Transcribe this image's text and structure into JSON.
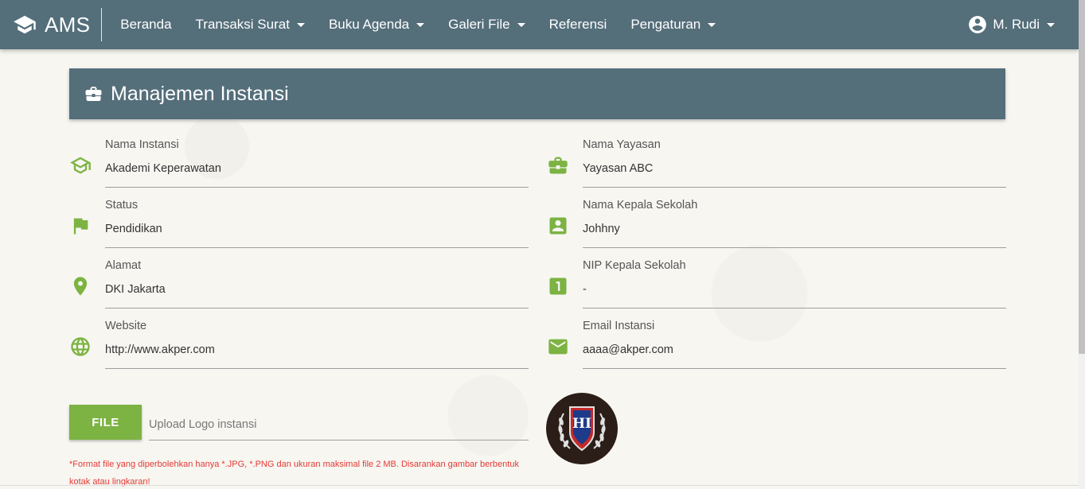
{
  "brand": {
    "name": "AMS",
    "icon": "graduation-cap-icon"
  },
  "nav": {
    "items": [
      {
        "label": "Beranda",
        "dropdown": false
      },
      {
        "label": "Transaksi Surat",
        "dropdown": true
      },
      {
        "label": "Buku Agenda",
        "dropdown": true
      },
      {
        "label": "Galeri File",
        "dropdown": true
      },
      {
        "label": "Referensi",
        "dropdown": false
      },
      {
        "label": "Pengaturan",
        "dropdown": true
      }
    ],
    "user": {
      "name": "M. Rudi",
      "icon": "account-circle-icon"
    }
  },
  "card": {
    "title": "Manajemen Instansi",
    "icon": "briefcase-icon"
  },
  "fields": {
    "nama_instansi": {
      "label": "Nama Instansi",
      "value": "Akademi Keperawatan",
      "icon": "school-icon"
    },
    "status": {
      "label": "Status",
      "value": "Pendidikan",
      "icon": "flag-icon"
    },
    "alamat": {
      "label": "Alamat",
      "value": "DKI Jakarta",
      "icon": "location-pin-icon"
    },
    "website": {
      "label": "Website",
      "value": "http://www.akper.com",
      "icon": "globe-icon"
    },
    "nama_yayasan": {
      "label": "Nama Yayasan",
      "value": "Yayasan ABC",
      "icon": "briefcase-icon"
    },
    "nama_kepala": {
      "label": "Nama Kepala Sekolah",
      "value": "Johhny",
      "icon": "contact-card-icon"
    },
    "nip_kepala": {
      "label": "NIP Kepala Sekolah",
      "value": "-",
      "icon": "number-one-box-icon"
    },
    "email": {
      "label": "Email Instansi",
      "value": "aaaa@akper.com",
      "icon": "email-icon"
    }
  },
  "upload": {
    "button_label": "FILE",
    "placeholder": "Upload Logo instansi",
    "note": "*Format file yang diperbolehkan hanya *.JPG, *.PNG dan ukuran maksimal file 2 MB. Disarankan gambar berbentuk kotak atau lingkaran!"
  },
  "logo": {
    "text": "HI"
  },
  "colors": {
    "primary": "#546e7a",
    "accent": "#7cb342",
    "warning": "#e53935"
  }
}
